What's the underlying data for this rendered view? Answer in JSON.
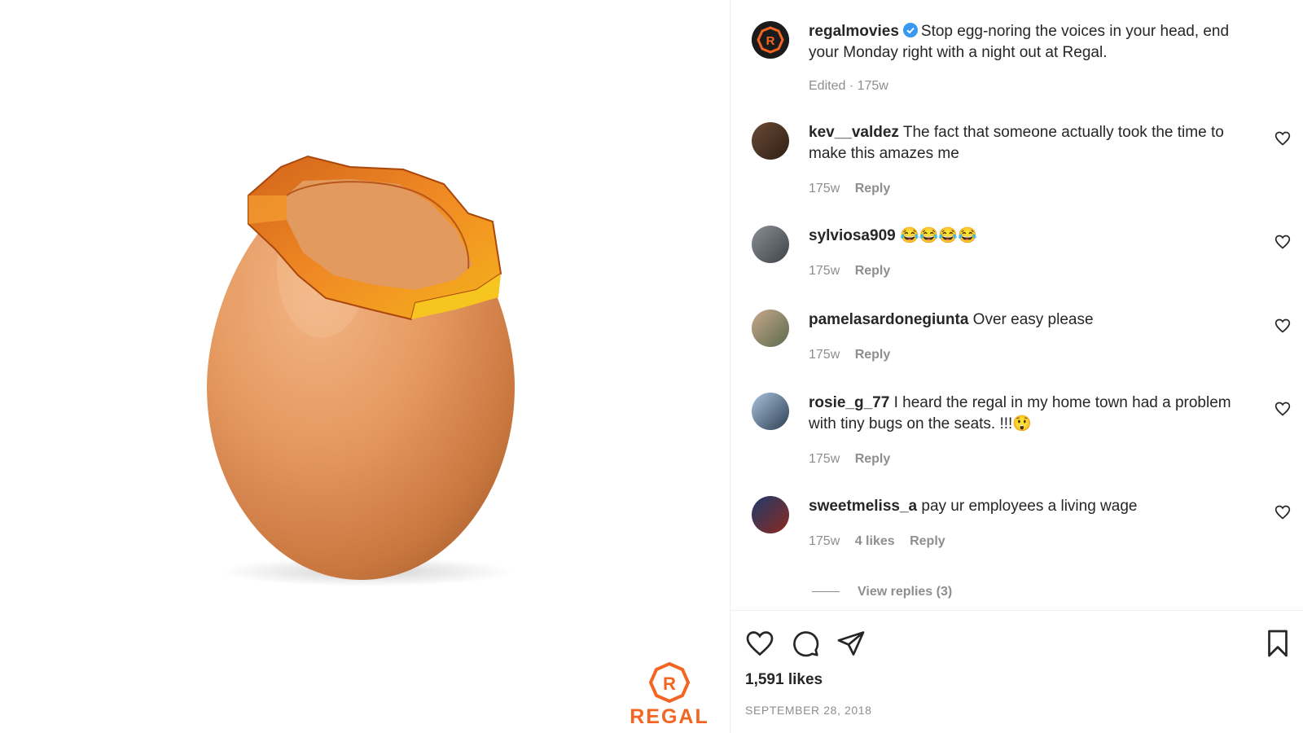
{
  "brand": {
    "wordmark": "REGAL",
    "accent_color": "#f26522"
  },
  "post": {
    "username": "regalmovies",
    "verified": true,
    "caption": "Stop egg-noring the voices in your head, end your Monday right with a night out at Regal.",
    "meta": "Edited · 175w"
  },
  "comments": [
    {
      "username": "kev__valdez",
      "text": "The fact that someone actually took the time to make this amazes me",
      "age": "175w",
      "likes": "",
      "reply": "Reply"
    },
    {
      "username": "sylviosa909",
      "text": "😂😂😂😂",
      "age": "175w",
      "likes": "",
      "reply": "Reply"
    },
    {
      "username": "pamelasardonegiunta",
      "text": "Over easy please",
      "age": "175w",
      "likes": "",
      "reply": "Reply"
    },
    {
      "username": "rosie_g_77",
      "text": "I heard the regal in my home town had a problem with tiny bugs on the seats. !!!😲",
      "age": "175w",
      "likes": "",
      "reply": "Reply"
    },
    {
      "username": "sweetmeliss_a",
      "text": "pay ur employees a living wage",
      "age": "175w",
      "likes": "4 likes",
      "reply": "Reply"
    }
  ],
  "view_replies": "View replies (3)",
  "actions": {
    "icons": [
      "heart-icon",
      "comment-icon",
      "share-icon",
      "bookmark-icon"
    ],
    "likes": "1,591 likes",
    "date": "SEPTEMBER 28, 2018"
  }
}
